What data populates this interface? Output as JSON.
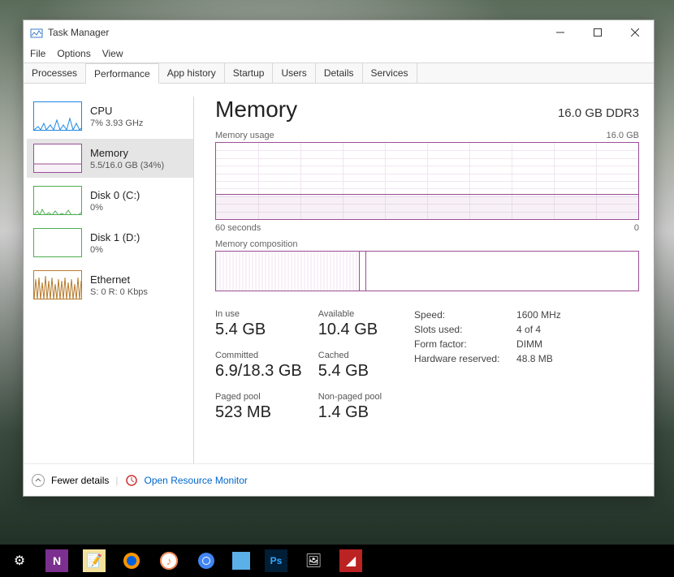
{
  "window": {
    "title": "Task Manager",
    "menu": [
      "File",
      "Options",
      "View"
    ],
    "tabs": [
      "Processes",
      "Performance",
      "App history",
      "Startup",
      "Users",
      "Details",
      "Services"
    ],
    "active_tab": 1
  },
  "sidebar": [
    {
      "name": "CPU",
      "stat": "7%  3.93 GHz",
      "color": "#1e88e5"
    },
    {
      "name": "Memory",
      "stat": "5.5/16.0 GB (34%)",
      "color": "#9b4f96"
    },
    {
      "name": "Disk 0 (C:)",
      "stat": "0%",
      "color": "#4caf50"
    },
    {
      "name": "Disk 1 (D:)",
      "stat": "0%",
      "color": "#4caf50"
    },
    {
      "name": "Ethernet",
      "stat": "S: 0  R: 0 Kbps",
      "color": "#b77b2b"
    }
  ],
  "main": {
    "title": "Memory",
    "subtitle": "16.0 GB DDR3",
    "usage_label": "Memory usage",
    "usage_max": "16.0 GB",
    "x_left": "60 seconds",
    "x_right": "0",
    "comp_label": "Memory composition"
  },
  "chart_data": {
    "type": "line",
    "title": "Memory usage",
    "ylabel": "GB",
    "ylim": [
      0,
      16.0
    ],
    "xlabel": "seconds ago",
    "x": [
      60,
      50,
      40,
      30,
      20,
      10,
      0
    ],
    "values": [
      5.4,
      5.4,
      5.4,
      5.4,
      5.5,
      5.5,
      5.5
    ]
  },
  "stats": {
    "in_use": {
      "label": "In use",
      "value": "5.4 GB"
    },
    "available": {
      "label": "Available",
      "value": "10.4 GB"
    },
    "committed": {
      "label": "Committed",
      "value": "6.9/18.3 GB"
    },
    "cached": {
      "label": "Cached",
      "value": "5.4 GB"
    },
    "paged": {
      "label": "Paged pool",
      "value": "523 MB"
    },
    "nonpaged": {
      "label": "Non-paged pool",
      "value": "1.4 GB"
    }
  },
  "hw": {
    "speed": {
      "k": "Speed:",
      "v": "1600 MHz"
    },
    "slots": {
      "k": "Slots used:",
      "v": "4 of 4"
    },
    "form": {
      "k": "Form factor:",
      "v": "DIMM"
    },
    "reserved": {
      "k": "Hardware reserved:",
      "v": "48.8 MB"
    }
  },
  "footer": {
    "fewer": "Fewer details",
    "resmon": "Open Resource Monitor"
  }
}
